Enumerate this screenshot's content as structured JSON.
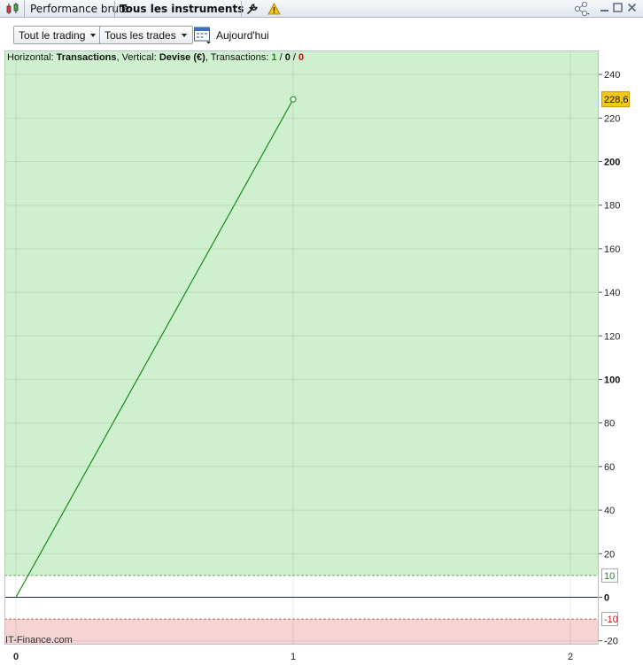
{
  "titlebar": {
    "tab_label": "Performance brute",
    "instruments_label": "Tous les instruments",
    "icons": [
      "candlestick-icon",
      "wrench-icon",
      "warning-icon",
      "share-icon",
      "minimize-icon",
      "maximize-icon",
      "close-icon"
    ]
  },
  "toolbar": {
    "trading_dropdown": "Tout le trading",
    "trades_dropdown": "Tous les trades",
    "today_label": "Aujourd'hui"
  },
  "chart_header": {
    "horizontal_label": "Horizontal:",
    "horizontal_value": "Transactions",
    "vertical_label": "Vertical:",
    "vertical_value": "Devise (€)",
    "transactions_label": "Transactions:",
    "count_win": "1",
    "count_neutral": "0",
    "count_loss": "0",
    "separator": "/",
    "comma": ","
  },
  "watermark": "IT-Finance.com",
  "colors": {
    "profit_zone": "#cff0cf",
    "loss_zone": "#f6d4d4",
    "line": "#1a8a1a",
    "value_badge": "#f2c81a",
    "threshold_upper": "#1a8a1a",
    "threshold_lower": "#c01010"
  },
  "chart_data": {
    "type": "line",
    "x": [
      0,
      1
    ],
    "series": [
      {
        "values": [
          0,
          228.6
        ]
      }
    ],
    "xlim": [
      0,
      2
    ],
    "ylim": [
      -20,
      250
    ],
    "x_ticks": [
      "0",
      "1",
      "2"
    ],
    "y_ticks": [
      240,
      220,
      200,
      180,
      160,
      140,
      120,
      100,
      80,
      60,
      40,
      20,
      0,
      -20
    ],
    "y_tick_labels": [
      "240",
      "220",
      "200",
      "180",
      "160",
      "140",
      "120",
      "100",
      "80",
      "60",
      "40",
      "20",
      "0",
      "-20"
    ],
    "bold_ticks": [
      200,
      100,
      0
    ],
    "upper_threshold": 10,
    "upper_threshold_label": "10",
    "lower_threshold": -10,
    "lower_threshold_label": "-10",
    "last_value_label": "228,6",
    "grid": true
  }
}
